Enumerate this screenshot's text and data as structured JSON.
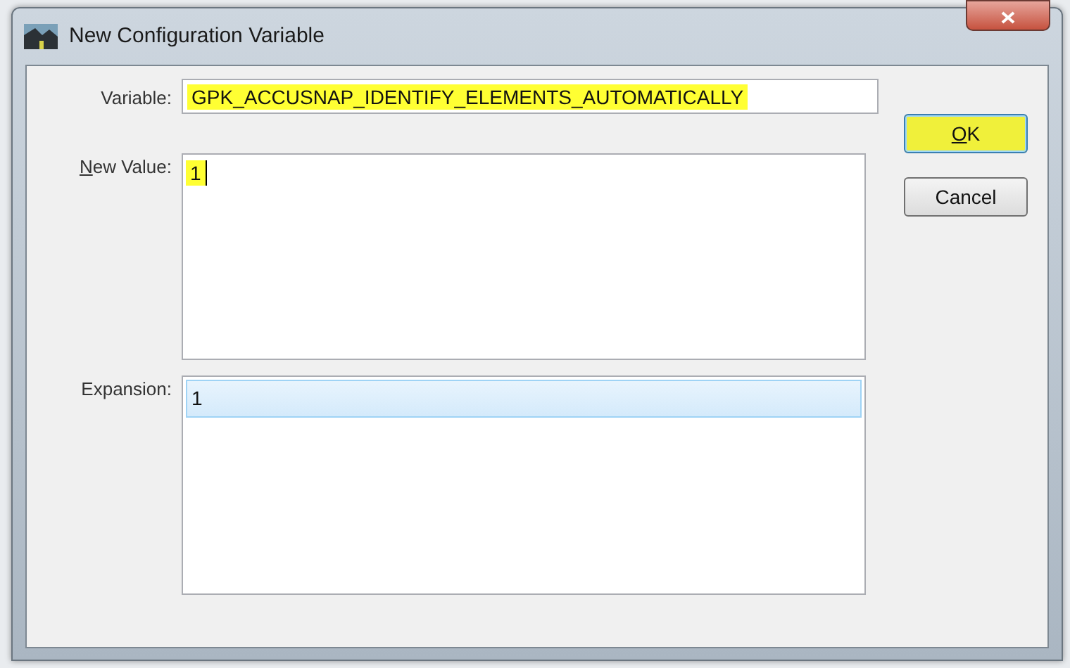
{
  "window": {
    "title": "New Configuration Variable"
  },
  "variable": {
    "label": "Variable:",
    "value": "GPK_ACCUSNAP_IDENTIFY_ELEMENTS_AUTOMATICALLY",
    "highlighted": true
  },
  "new_value": {
    "label": "New Value:",
    "value": "1",
    "highlighted": true
  },
  "expansion": {
    "label": "Expansion:",
    "items": [
      {
        "text": "1",
        "selected": true
      }
    ]
  },
  "buttons": [
    {
      "label": "OK",
      "default": true,
      "highlighted": true
    },
    {
      "label": "Cancel",
      "default": false,
      "highlighted": false
    }
  ]
}
